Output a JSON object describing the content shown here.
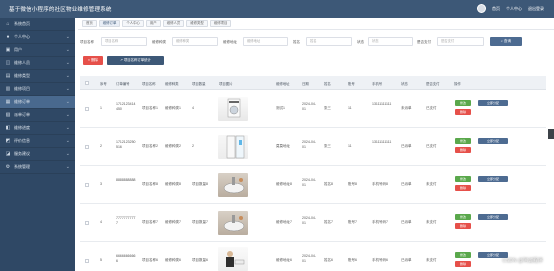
{
  "app": {
    "title": "基于微信小程序的社区物业维修管理系统"
  },
  "topbar": {
    "home": "首页",
    "profile": "个人中心",
    "logout": "退出登录"
  },
  "sidebar": {
    "items": [
      {
        "label": "系统首页",
        "icon": "home-icon"
      },
      {
        "label": "个人中心",
        "icon": "user-icon"
      },
      {
        "label": "用户",
        "icon": "users-icon"
      },
      {
        "label": "维修人员",
        "icon": "worker-icon"
      },
      {
        "label": "维修类型",
        "icon": "tag-icon"
      },
      {
        "label": "维修项目",
        "icon": "tool-icon"
      },
      {
        "label": "维修订单",
        "icon": "order-icon"
      },
      {
        "label": "派单订单",
        "icon": "dispatch-icon"
      },
      {
        "label": "维修进度",
        "icon": "progress-icon"
      },
      {
        "label": "评价信息",
        "icon": "comment-icon"
      },
      {
        "label": "服务建议",
        "icon": "suggest-icon"
      },
      {
        "label": "系统管理",
        "icon": "gear-icon"
      }
    ]
  },
  "tabs": [
    "首页",
    "维修订单",
    "个人中心",
    "用户",
    "维修人员",
    "维修类型",
    "维修项目"
  ],
  "filters": [
    {
      "label": "项目名称",
      "placeholder": "项目名称"
    },
    {
      "label": "维修种类",
      "placeholder": "维修种类"
    },
    {
      "label": "维修地址",
      "placeholder": "维修地址"
    },
    {
      "label": "姓名",
      "placeholder": "姓名"
    },
    {
      "label": "状态",
      "placeholder": "状态"
    },
    {
      "label": "是否支付",
      "placeholder": "是否支付"
    }
  ],
  "buttons": {
    "query": "查询",
    "delete": "删除",
    "stats": "项目名称订单统计",
    "edit": "修改",
    "assign": "立即分配",
    "remove": "删除"
  },
  "table": {
    "headers": [
      "序号",
      "订单编号",
      "项目名称",
      "维修种类",
      "项目数量",
      "项目图片",
      "维修地址",
      "日期",
      "姓名",
      "账号",
      "手机号",
      "状态",
      "是否支付",
      "操作"
    ],
    "rows": [
      {
        "index": "1",
        "order": "1712123414450",
        "project": "项目名称1",
        "type": "维修种类1",
        "count": "4",
        "image": "washer",
        "address": "测试1",
        "date": "2024-04-01",
        "name": "张三",
        "account": "11",
        "phone": "13111111111",
        "status": "未派单",
        "paid": "已支付"
      },
      {
        "index": "2",
        "order": "1712123250516",
        "project": "项目名称2",
        "type": "维修种类2",
        "count": "2",
        "image": "fridge",
        "address": "莫莫地址",
        "date": "2024-04-01",
        "name": "张三",
        "account": "11",
        "phone": "13111111111",
        "status": "已派单",
        "paid": "已支付"
      },
      {
        "index": "3",
        "order": "8888888888",
        "project": "项目名称8",
        "type": "维修种类8",
        "count": "项目数量8",
        "image": "sink",
        "address": "维修地址8",
        "date": "2024-04-01",
        "name": "姓名8",
        "account": "账号8",
        "phone": "手机号码8",
        "status": "已派单",
        "paid": "未支付"
      },
      {
        "index": "4",
        "order": "77777777777",
        "project": "项目名称7",
        "type": "维修种类7",
        "count": "项目数量7",
        "image": "sink",
        "address": "维修地址7",
        "date": "2024-04-01",
        "name": "姓名7",
        "account": "账号7",
        "phone": "手机号码7",
        "status": "已派单",
        "paid": "未支付"
      },
      {
        "index": "5",
        "order": "66666666666",
        "project": "项目名称6",
        "type": "维修种类6",
        "count": "项目数量6",
        "image": "plumber",
        "address": "维修地址6",
        "date": "2024-04-01",
        "name": "姓名6",
        "account": "账号6",
        "phone": "手机号码6",
        "status": "已派单",
        "paid": "未支付"
      }
    ]
  },
  "watermark": "CSDN @阿诚程序"
}
